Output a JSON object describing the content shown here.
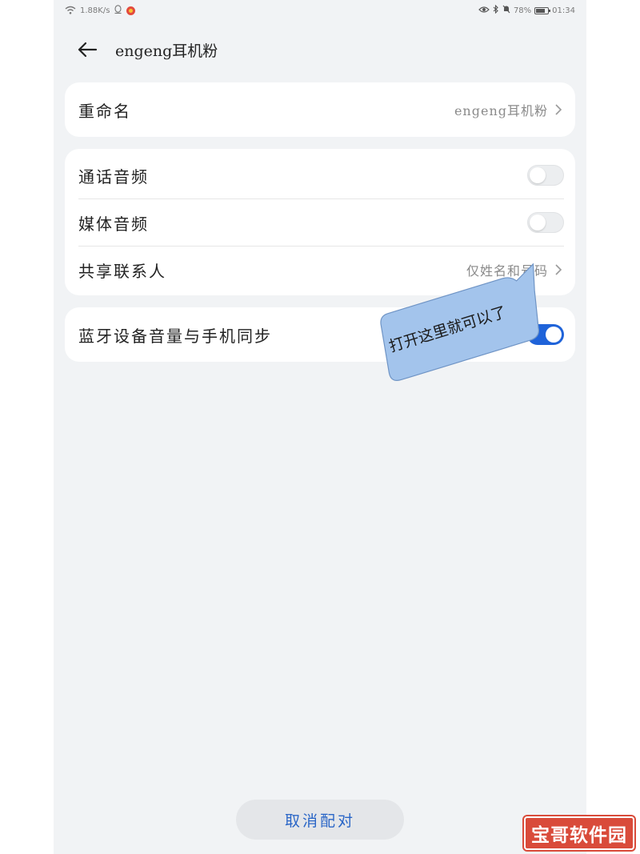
{
  "status_bar": {
    "speed": "1.88K/s",
    "battery": "78%",
    "battery_level": 0.78,
    "time": "01:34",
    "icons": [
      "wifi-icon",
      "qq-icon",
      "weibo-icon",
      "eye-icon",
      "bluetooth-icon",
      "mute-bell-icon",
      "battery-icon"
    ]
  },
  "header": {
    "back_icon": "arrow-left-icon",
    "title": "engeng耳机粉"
  },
  "rename": {
    "label": "重命名",
    "value": "engeng耳机粉"
  },
  "audio": {
    "call_label": "通话音频",
    "call_on": false,
    "media_label": "媒体音频",
    "media_on": false,
    "contacts_label": "共享联系人",
    "contacts_value": "仅姓名和号码"
  },
  "volume_sync": {
    "label": "蓝牙设备音量与手机同步",
    "on": true
  },
  "annotation": {
    "text": "打开这里就可以了"
  },
  "unpair": {
    "label": "取消配对"
  },
  "watermark": {
    "text": "宝哥软件园"
  },
  "colors": {
    "background": "#f1f3f5",
    "card": "#ffffff",
    "toggle_on": "#1f63d9",
    "accent_text": "#2a66c7",
    "bubble": "#a3c4ec",
    "watermark_red": "#d94b3a"
  }
}
